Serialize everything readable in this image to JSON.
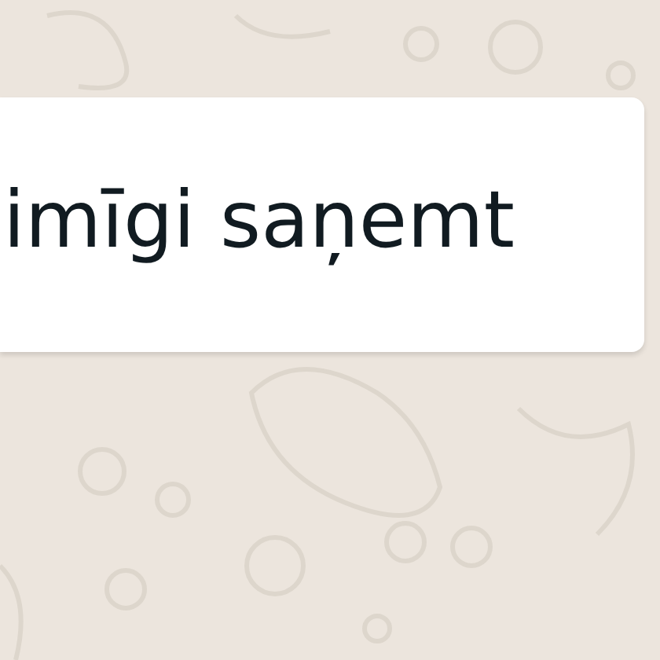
{
  "message": {
    "text": "imīgi saņemt"
  }
}
